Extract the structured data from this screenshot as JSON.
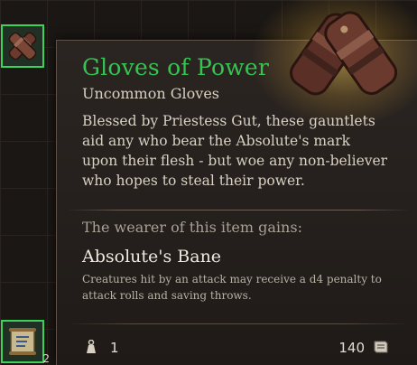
{
  "item": {
    "name": "Gloves of Power",
    "rarity_type": "Uncommon Gloves",
    "description": "Blessed by Priestess Gut, these gauntlets aid any who bear the Absolute's mark upon their flesh - but woe any non-believer who hopes to steal their power.",
    "gains_header": "The wearer of this item gains:",
    "effect": {
      "name": "Absolute's Bane",
      "description": "Creatures hit by an attack may receive a d4 penalty to attack rolls and saving throws."
    },
    "weight": "1",
    "price": "140",
    "icons": {
      "art": "gauntlets-icon",
      "weight": "weight-icon",
      "price": "gold-coin-icon"
    },
    "colors": {
      "rarity_name": "#36c352",
      "slot_border": "#3bd35a"
    }
  },
  "inventory": {
    "slots": [
      {
        "icon": "gauntlets-icon",
        "count": ""
      },
      {
        "icon": "scroll-icon",
        "count": "2"
      }
    ]
  }
}
